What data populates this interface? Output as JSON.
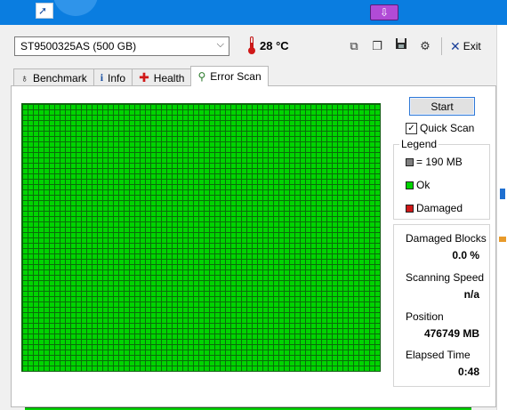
{
  "window": {
    "drive_select": {
      "value": "ST9500325AS (500 GB)"
    },
    "temperature": "28 °C",
    "toolbar": {
      "copy_icon": "copy-icon",
      "copy_all_icon": "copy-all-icon",
      "save_icon": "save-icon",
      "options_icon": "options-icon",
      "exit_label": "Exit"
    }
  },
  "tabs": [
    {
      "label": "Benchmark",
      "icon": "stopwatch-icon"
    },
    {
      "label": "Info",
      "icon": "info-icon"
    },
    {
      "label": "Health",
      "icon": "health-cross-icon"
    },
    {
      "label": "Error Scan",
      "icon": "magnifier-icon",
      "active": true
    }
  ],
  "error_scan": {
    "start_label": "Start",
    "quick_scan_label": "Quick Scan",
    "quick_scan_checked": true,
    "legend": {
      "title": "Legend",
      "block_size": "= 190 MB",
      "ok_label": "Ok",
      "damaged_label": "Damaged"
    },
    "stats": {
      "damaged_blocks_label": "Damaged Blocks",
      "damaged_blocks_value": "0.0 %",
      "scanning_speed_label": "Scanning Speed",
      "scanning_speed_value": "n/a",
      "position_label": "Position",
      "position_value": "476749 MB",
      "elapsed_label": "Elapsed Time",
      "elapsed_value": "0:48"
    },
    "scan_progress": 1.0
  },
  "colors": {
    "ok_block": "#00d400",
    "block_grid": "#0b6b0b",
    "damaged_block": "#d01818",
    "size_block": "#7f7f7f"
  }
}
